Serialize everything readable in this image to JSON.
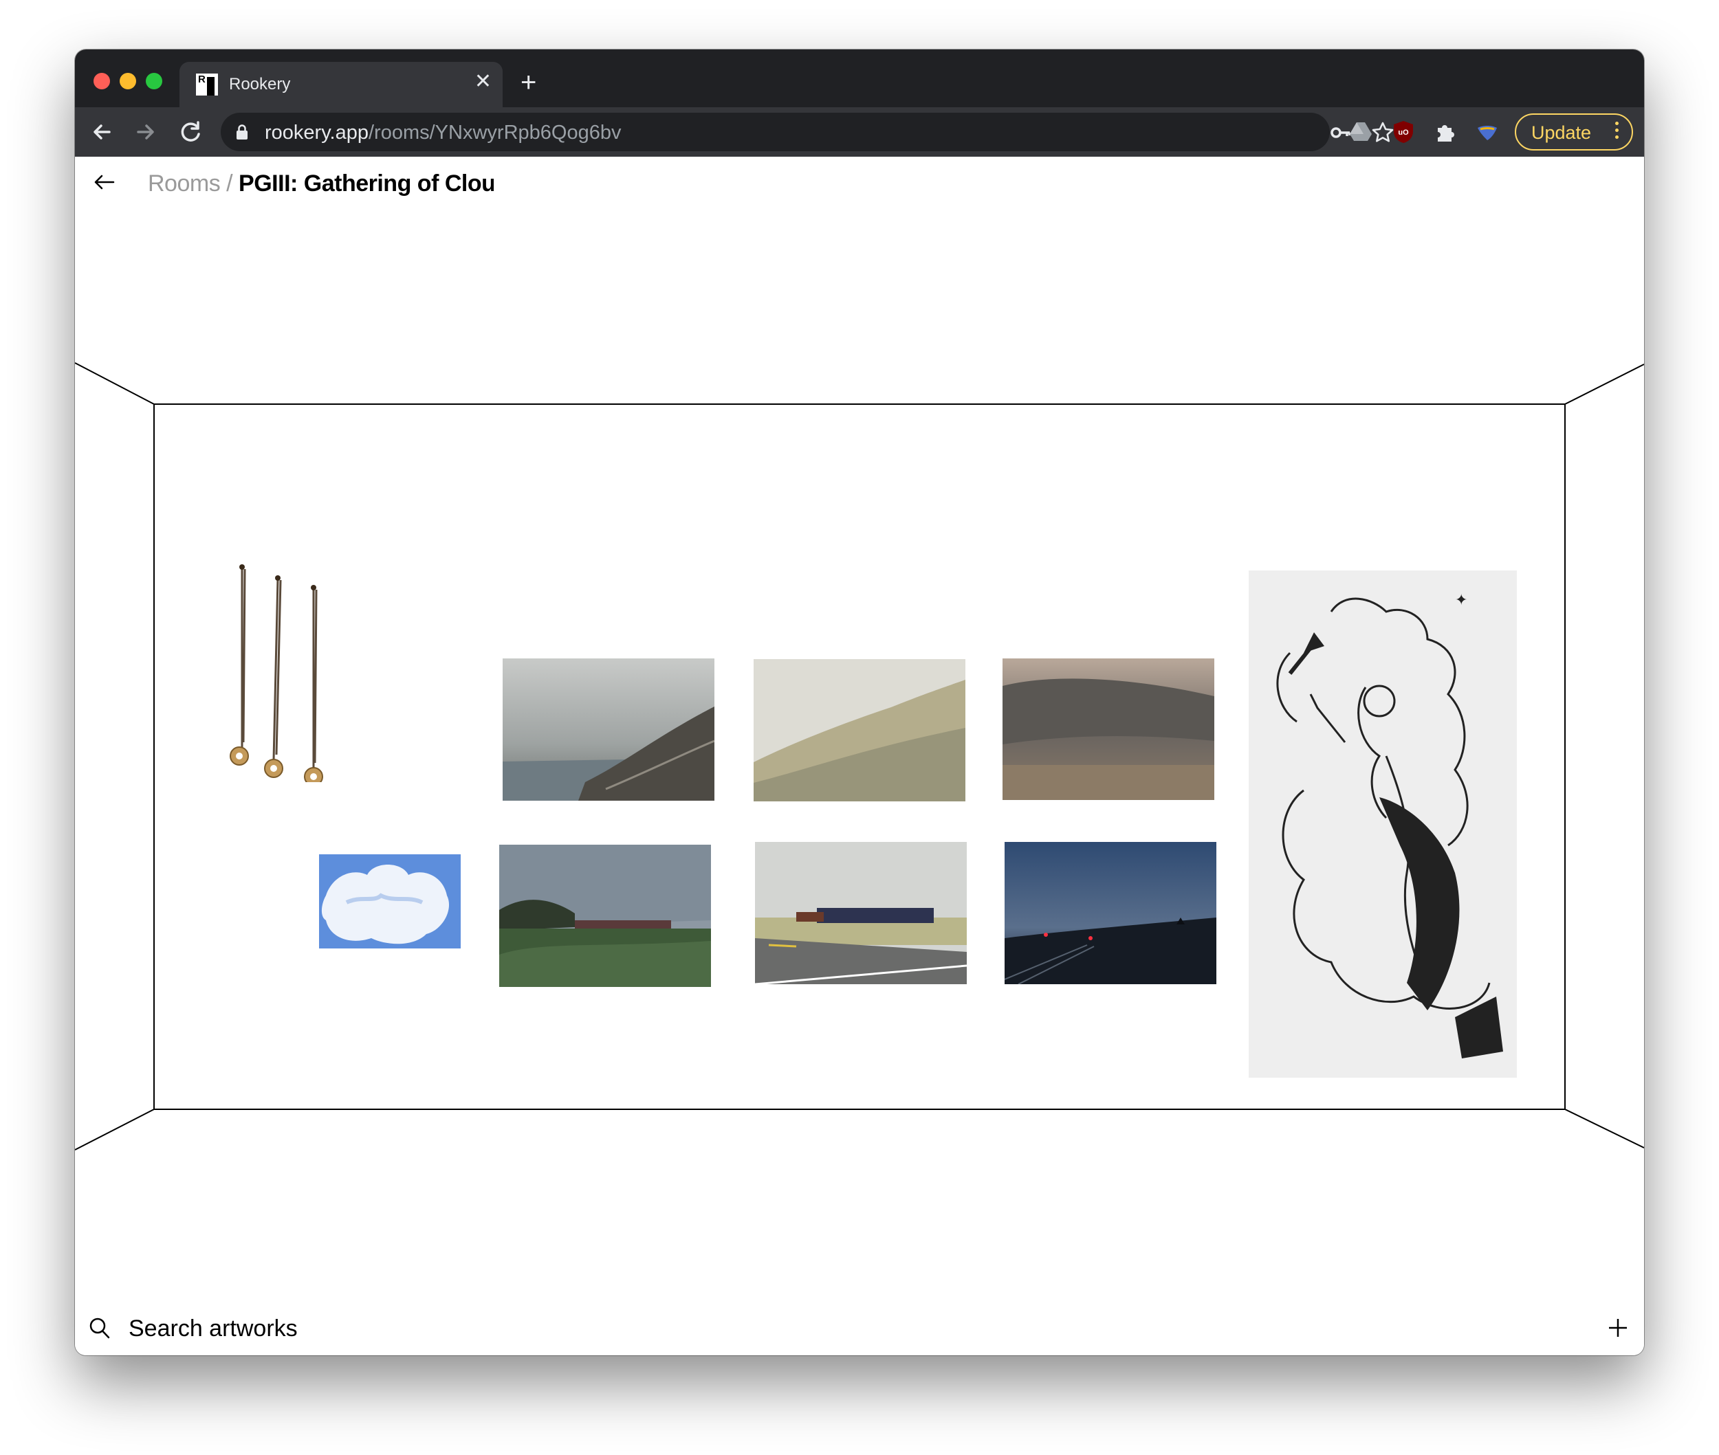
{
  "browser": {
    "tab_title": "Rookery",
    "favicon_letter": "R",
    "url_host": "rookery.app",
    "url_path": "/rooms/YNxwyrRpb6Qog6bv",
    "update_label": "Update",
    "accent_color": "#fdd663"
  },
  "page": {
    "breadcrumb_root": "Rooms",
    "breadcrumb_separator": " / ",
    "room_title": "PGIII: Gathering of Clouds"
  },
  "artworks": [
    {
      "name": "artwork-pins-sculpture",
      "subject": "three hanging pins"
    },
    {
      "name": "artwork-cloud-blue",
      "subject": "white cloud on blue sky"
    },
    {
      "name": "artwork-coast-fog",
      "subject": "foggy coastline"
    },
    {
      "name": "artwork-misty-hillside",
      "subject": "misty hillside"
    },
    {
      "name": "artwork-cloud-field",
      "subject": "cloud bank over field"
    },
    {
      "name": "artwork-train-field",
      "subject": "train passing field"
    },
    {
      "name": "artwork-train-road",
      "subject": "train beside road"
    },
    {
      "name": "artwork-dusk-tracks",
      "subject": "dusk over tracks"
    },
    {
      "name": "artwork-woman-cloud-drawing",
      "subject": "ink drawing of woman in clouds"
    }
  ],
  "footer": {
    "search_label": "Search artworks"
  }
}
